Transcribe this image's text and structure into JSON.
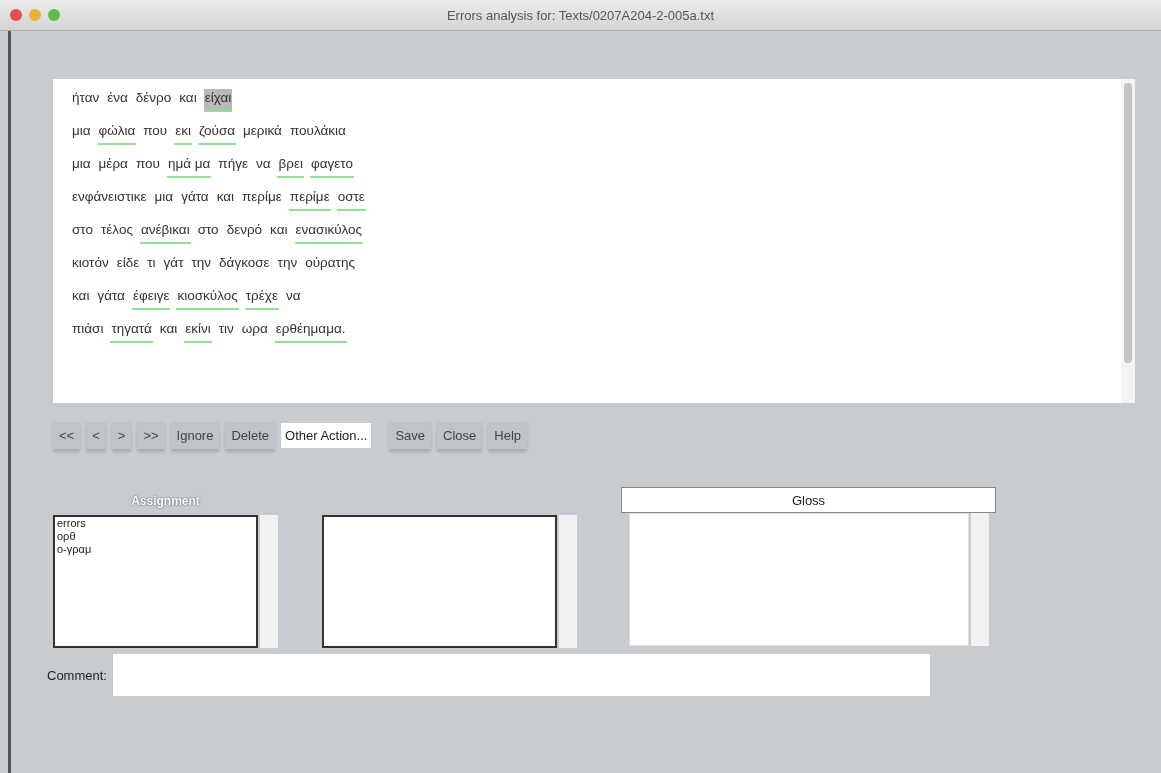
{
  "window": {
    "title": "Errors analysis for: Texts/0207A204-2-005a.txt"
  },
  "text_lines": [
    {
      "words": [
        {
          "text": "ήταν",
          "marked": false,
          "selected": false
        },
        {
          "text": "ένα",
          "marked": false,
          "selected": false
        },
        {
          "text": "δένρο",
          "marked": false,
          "selected": false
        },
        {
          "text": "και",
          "marked": false,
          "selected": false
        },
        {
          "text": "είχαι",
          "marked": true,
          "selected": true
        }
      ]
    },
    {
      "words": [
        {
          "text": "μια",
          "marked": false,
          "selected": false
        },
        {
          "text": "φώλια",
          "marked": true,
          "selected": false
        },
        {
          "text": "που",
          "marked": false,
          "selected": false
        },
        {
          "text": "εκι",
          "marked": true,
          "selected": false
        },
        {
          "text": "ζούσα",
          "marked": true,
          "selected": false
        },
        {
          "text": "μερικά",
          "marked": false,
          "selected": false
        },
        {
          "text": "πουλάκια",
          "marked": false,
          "selected": false
        }
      ]
    },
    {
      "words": [
        {
          "text": "μια",
          "marked": false,
          "selected": false
        },
        {
          "text": "μέρα",
          "marked": false,
          "selected": false
        },
        {
          "text": "που",
          "marked": false,
          "selected": false
        },
        {
          "text": "ημά μα",
          "marked": true,
          "selected": false
        },
        {
          "text": "πήγε",
          "marked": false,
          "selected": false
        },
        {
          "text": "να",
          "marked": false,
          "selected": false
        },
        {
          "text": "βρει",
          "marked": true,
          "selected": false
        },
        {
          "text": "φαγετο",
          "marked": true,
          "selected": false
        }
      ]
    },
    {
      "words": [
        {
          "text": "ενφάνειστικε",
          "marked": false,
          "selected": false
        },
        {
          "text": "μια",
          "marked": false,
          "selected": false
        },
        {
          "text": "γάτα",
          "marked": false,
          "selected": false
        },
        {
          "text": "και",
          "marked": false,
          "selected": false
        },
        {
          "text": "περίμε",
          "marked": false,
          "selected": false
        },
        {
          "text": "περίμε",
          "marked": true,
          "selected": false
        },
        {
          "text": "οστε",
          "marked": true,
          "selected": false
        }
      ]
    },
    {
      "words": [
        {
          "text": "στο",
          "marked": false,
          "selected": false
        },
        {
          "text": "τέλος",
          "marked": false,
          "selected": false
        },
        {
          "text": "ανέβικαι",
          "marked": true,
          "selected": false
        },
        {
          "text": "στο",
          "marked": false,
          "selected": false
        },
        {
          "text": "δενρό",
          "marked": false,
          "selected": false
        },
        {
          "text": "και",
          "marked": false,
          "selected": false
        },
        {
          "text": "ενασικύλος",
          "marked": true,
          "selected": false
        }
      ]
    },
    {
      "words": [
        {
          "text": "κιοτόν",
          "marked": false,
          "selected": false
        },
        {
          "text": "είδε",
          "marked": false,
          "selected": false
        },
        {
          "text": "τι",
          "marked": false,
          "selected": false
        },
        {
          "text": "γάτ",
          "marked": false,
          "selected": false
        },
        {
          "text": "την",
          "marked": false,
          "selected": false
        },
        {
          "text": "δάγκοσε",
          "marked": false,
          "selected": false
        },
        {
          "text": "την",
          "marked": false,
          "selected": false
        },
        {
          "text": "ούρατης",
          "marked": false,
          "selected": false
        }
      ]
    },
    {
      "words": [
        {
          "text": "και",
          "marked": false,
          "selected": false
        },
        {
          "text": "γάτα",
          "marked": false,
          "selected": false
        },
        {
          "text": "έφειγε",
          "marked": true,
          "selected": false
        },
        {
          "text": "κιοσκύλος",
          "marked": true,
          "selected": false
        },
        {
          "text": "τρέχε",
          "marked": true,
          "selected": false
        },
        {
          "text": "να",
          "marked": false,
          "selected": false
        }
      ]
    },
    {
      "words": [
        {
          "text": "πιάσι",
          "marked": false,
          "selected": false
        },
        {
          "text": "τηγατά",
          "marked": true,
          "selected": false
        },
        {
          "text": "και",
          "marked": false,
          "selected": false
        },
        {
          "text": "εκίνι",
          "marked": true,
          "selected": false
        },
        {
          "text": "τιν",
          "marked": false,
          "selected": false
        },
        {
          "text": "ωρα",
          "marked": false,
          "selected": false
        },
        {
          "text": "ερθέημαμα.",
          "marked": true,
          "selected": false
        }
      ]
    }
  ],
  "toolbar": [
    {
      "kind": "button",
      "label": "<<"
    },
    {
      "kind": "button",
      "label": "<"
    },
    {
      "kind": "button",
      "label": ">"
    },
    {
      "kind": "button",
      "label": ">>"
    },
    {
      "kind": "button",
      "label": "Ignore"
    },
    {
      "kind": "button",
      "label": "Delete"
    },
    {
      "kind": "dropdown",
      "label": "Other Action..."
    },
    {
      "kind": "button",
      "label": "Save"
    },
    {
      "kind": "button",
      "label": "Close"
    },
    {
      "kind": "button",
      "label": "Help"
    }
  ],
  "assignment": {
    "header": "Assignment",
    "items": [
      "errors",
      "ορθ",
      "ο-γραμ"
    ]
  },
  "gloss": {
    "header": "Gloss"
  },
  "comment": {
    "label": "Comment:"
  }
}
